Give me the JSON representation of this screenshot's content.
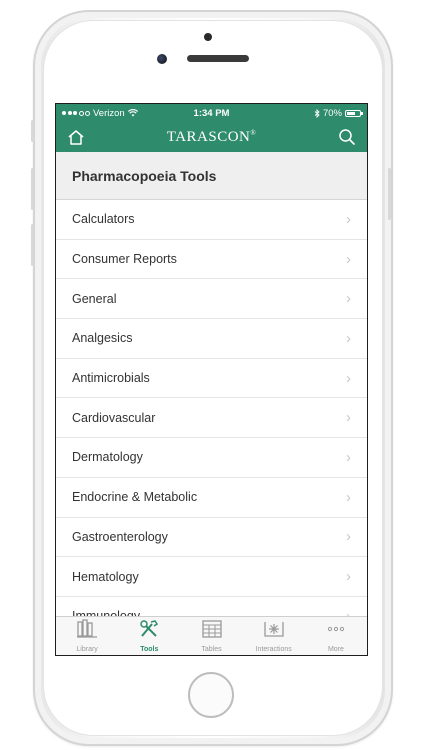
{
  "status": {
    "carrier": "Verizon",
    "time": "1:34 PM",
    "battery": "70%",
    "battery_level": 0.7
  },
  "nav": {
    "title": "TARASCON",
    "trademark": "®",
    "home_icon": "home-icon",
    "search_icon": "search-icon"
  },
  "section": {
    "title": "Pharmacopoeia Tools"
  },
  "list": [
    {
      "label": "Calculators"
    },
    {
      "label": "Consumer Reports"
    },
    {
      "label": "General"
    },
    {
      "label": "Analgesics"
    },
    {
      "label": "Antimicrobials"
    },
    {
      "label": "Cardiovascular"
    },
    {
      "label": "Dermatology"
    },
    {
      "label": "Endocrine & Metabolic"
    },
    {
      "label": "Gastroenterology"
    },
    {
      "label": "Hematology"
    },
    {
      "label": "Immunology"
    }
  ],
  "chevron": "›",
  "tabs": [
    {
      "label": "Library",
      "icon": "library-icon"
    },
    {
      "label": "Tools",
      "icon": "tools-icon",
      "active": true
    },
    {
      "label": "Tables",
      "icon": "tables-icon"
    },
    {
      "label": "Interactions",
      "icon": "interactions-icon"
    },
    {
      "label": "More",
      "icon": "more-icon"
    }
  ],
  "colors": {
    "accent": "#2e8b6c",
    "inactive": "#9a9a9a"
  }
}
